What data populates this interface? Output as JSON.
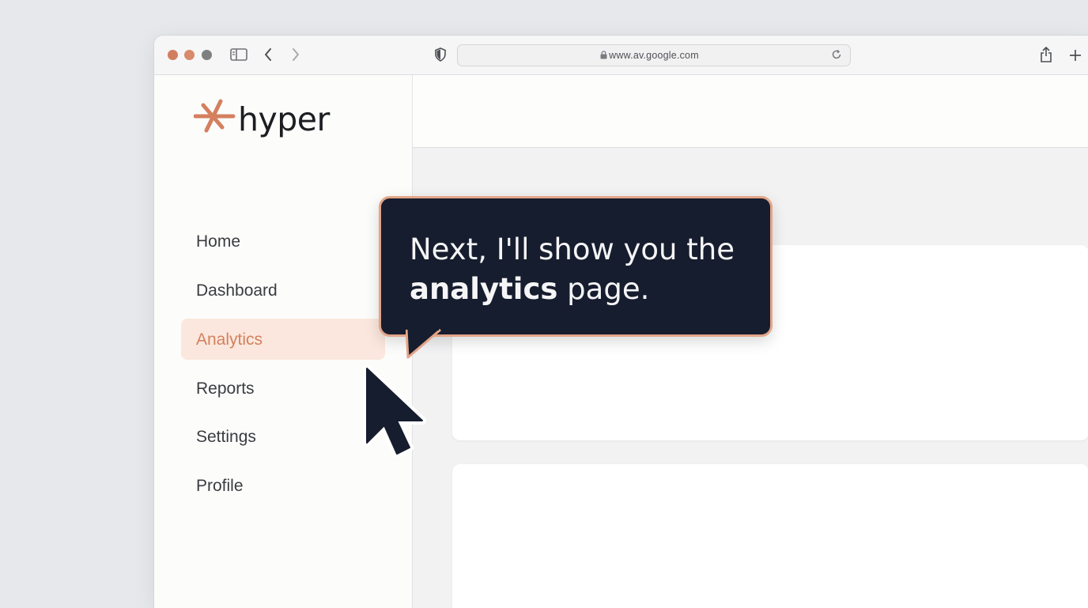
{
  "browser": {
    "url": "www.av.google.com",
    "traffic_lights": [
      "#d27d60",
      "#d88a6a",
      "#7d7f80"
    ],
    "icons": [
      "sidebar-toggle-icon",
      "back-icon",
      "forward-icon",
      "shield-icon",
      "lock-icon",
      "reload-icon",
      "share-icon",
      "new-tab-icon"
    ]
  },
  "sidebar": {
    "logo_text": "hyper",
    "accent": "#d4805e",
    "items": [
      {
        "label": "Home",
        "active": false
      },
      {
        "label": "Dashboard",
        "active": false
      },
      {
        "label": "Analytics",
        "active": true
      },
      {
        "label": "Reports",
        "active": false
      },
      {
        "label": "Settings",
        "active": false
      },
      {
        "label": "Profile",
        "active": false
      }
    ]
  },
  "tooltip": {
    "line1": "Next, I'll show you the",
    "bold": "analytics",
    "rest": " page."
  }
}
